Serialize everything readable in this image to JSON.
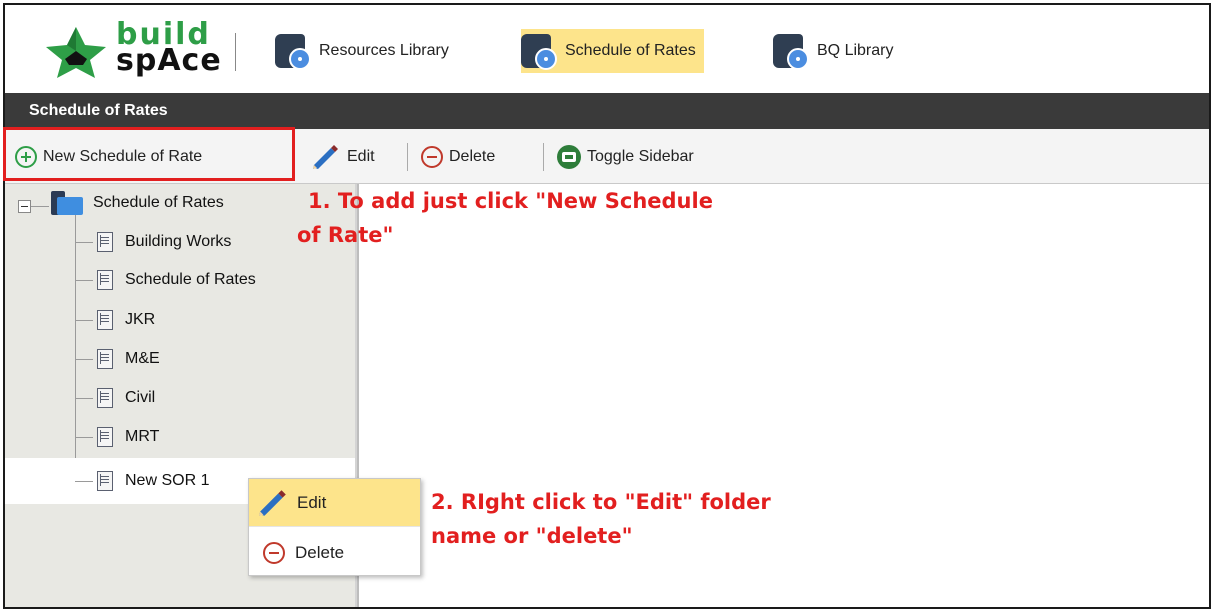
{
  "brand": {
    "line1": "build",
    "line2": "spAce"
  },
  "modules": [
    {
      "label": "Resources Library",
      "active": false
    },
    {
      "label": "Schedule of Rates",
      "active": true
    },
    {
      "label": "BQ Library",
      "active": false
    }
  ],
  "panel_title": "Schedule of Rates",
  "toolbar": {
    "new_label": "New Schedule of Rate",
    "edit_label": "Edit",
    "delete_label": "Delete",
    "toggle_label": "Toggle Sidebar"
  },
  "tree": {
    "root": "Schedule of Rates",
    "items": [
      "Building Works",
      "Schedule of Rates",
      "JKR",
      "M&E",
      "Civil",
      "MRT",
      "New SOR 1"
    ],
    "selected_item": "New SOR 1"
  },
  "context_menu": {
    "edit_label": "Edit",
    "delete_label": "Delete"
  },
  "annotations": {
    "step1_line1": "1. To add just click \"New Schedule",
    "step1_line2": "of Rate\"",
    "step2_line1": "2. RIght click to \"Edit\" folder",
    "step2_line2": "name or \"delete\""
  },
  "colors": {
    "accent_yellow": "#fde48b",
    "annotation_red": "#e21f1f",
    "titlebar": "#3a3a3a",
    "brand_green": "#2e9e47"
  }
}
